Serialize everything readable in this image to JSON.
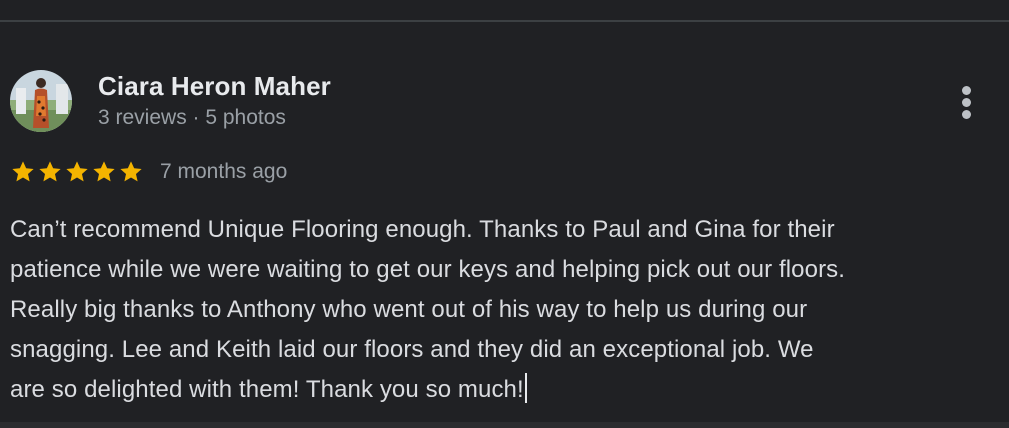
{
  "reviewer": {
    "name": "Ciara Heron Maher",
    "meta": "3 reviews · 5 photos"
  },
  "review": {
    "rating": 5,
    "rating_max": 5,
    "date": "7 months ago",
    "text_lines": [
      "Can’t recommend Unique Flooring enough. Thanks to Paul and Gina for their",
      "patience while we were waiting to get our keys and helping pick out our floors.",
      "Really big thanks to Anthony who went out of his way to help us during our",
      "snagging. Lee and Keith laid our floors and they did an exceptional job. We",
      "are so delighted with them! Thank you so much!"
    ]
  },
  "icons": {
    "menu": "more-vert-icon",
    "star": "star-icon"
  },
  "colors": {
    "background": "#202124",
    "star": "#f4b400",
    "name": "#e8eaed",
    "secondary": "#9aa0a6",
    "body_text": "#dadce0"
  }
}
